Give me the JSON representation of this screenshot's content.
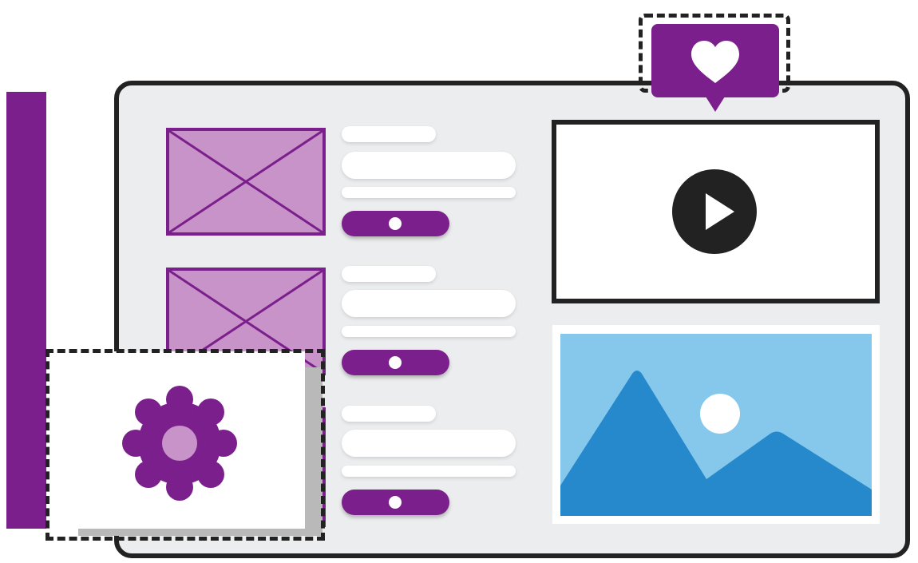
{
  "colors": {
    "purple": "#7b1f8c",
    "light_purple": "#c893c8",
    "panel": "#ecedee",
    "frame": "#222222",
    "sky": "#86c8ec",
    "mountain": "#2589cc"
  },
  "icons": {
    "like": "heart-icon",
    "video": "play-icon",
    "settings": "gear-icon",
    "media": "landscape-image-icon",
    "placeholder": "image-placeholder-icon"
  },
  "list_items": [
    {
      "toggle": "on"
    },
    {
      "toggle": "on"
    },
    {
      "toggle": "on"
    }
  ]
}
